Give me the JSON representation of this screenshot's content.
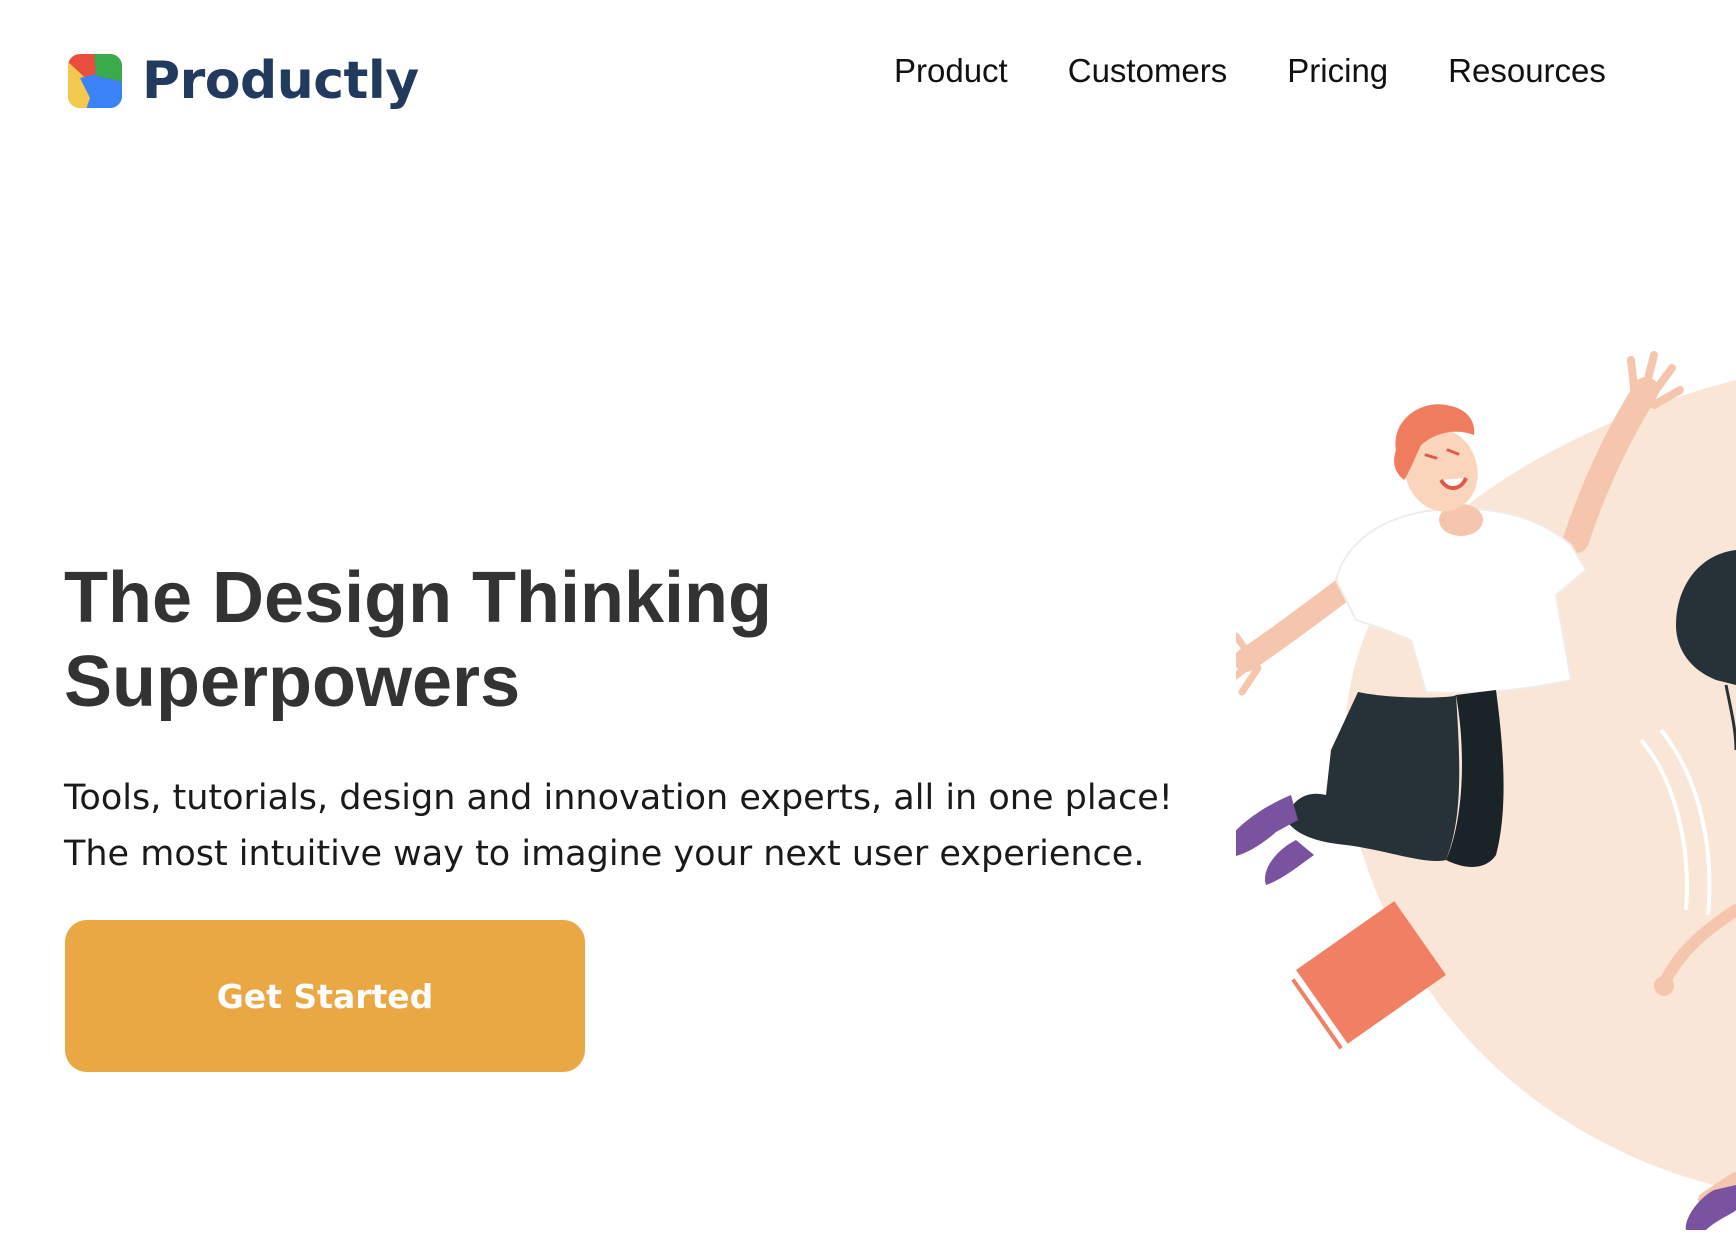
{
  "brand": {
    "name": "Productly",
    "logo_icon": "four-color-square-logo"
  },
  "nav": {
    "items": [
      {
        "label": "Product"
      },
      {
        "label": "Customers"
      },
      {
        "label": "Pricing"
      },
      {
        "label": "Resources"
      }
    ]
  },
  "hero": {
    "title_line1": "The Design Thinking",
    "title_line2": "Superpowers",
    "subtitle_line1": "Tools, tutorials, design and innovation experts, all in one place!",
    "subtitle_line2": "The most intuitive way to imagine your next user experience.",
    "cta_label": "Get Started"
  },
  "illustration": {
    "icon": "jumping-people-illustration"
  },
  "colors": {
    "brand_text": "#223a5e",
    "cta_background": "#eaa845",
    "heading": "#333333",
    "illustration_blob": "#fae6d6"
  }
}
